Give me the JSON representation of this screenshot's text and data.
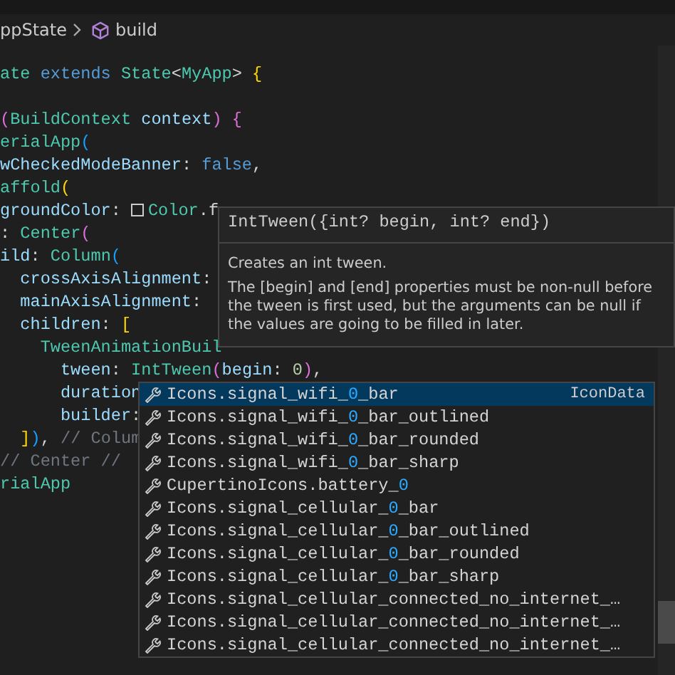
{
  "breadcrumb": {
    "parent": "ppState",
    "current": "build"
  },
  "code_lines": [
    {
      "tokens": [
        {
          "kind": "type",
          "text": "ate"
        },
        {
          "kind": "kw",
          "text": " extends"
        },
        {
          "kind": "type",
          "text": " State"
        },
        {
          "kind": "plain",
          "text": "<"
        },
        {
          "kind": "type",
          "text": "MyApp"
        },
        {
          "kind": "plain",
          "text": ">"
        },
        {
          "kind": "brace",
          "text": " {"
        }
      ]
    },
    {
      "blank_before": true,
      "tokens": [
        {
          "kind": "brace2",
          "text": "("
        },
        {
          "kind": "type",
          "text": "BuildContext"
        },
        {
          "kind": "prop",
          "text": " context"
        },
        {
          "kind": "brace2",
          "text": ")"
        },
        {
          "kind": "brace2",
          "text": " {"
        }
      ]
    },
    {
      "tokens": [
        {
          "kind": "type",
          "text": "erialApp"
        },
        {
          "kind": "brace3",
          "text": "("
        }
      ]
    },
    {
      "tokens": [
        {
          "kind": "prop",
          "text": "wCheckedModeBanner"
        },
        {
          "kind": "plain",
          "text": ":"
        },
        {
          "kind": "kw",
          "text": " false"
        },
        {
          "kind": "plain",
          "text": ","
        }
      ]
    },
    {
      "tokens": [
        {
          "kind": "type",
          "text": "affold"
        },
        {
          "kind": "brace",
          "text": "("
        }
      ]
    },
    {
      "tokens": [
        {
          "kind": "prop",
          "text": "groundColor"
        },
        {
          "kind": "plain",
          "text": ":"
        },
        {
          "kind": "swatch"
        },
        {
          "kind": "type",
          "text": "Color"
        },
        {
          "kind": "plain",
          "text": ".f"
        }
      ]
    },
    {
      "tokens": [
        {
          "kind": "plain",
          "text": ":"
        },
        {
          "kind": "type",
          "text": " Center"
        },
        {
          "kind": "brace2",
          "text": "("
        }
      ]
    },
    {
      "tokens": [
        {
          "kind": "prop",
          "text": "ild"
        },
        {
          "kind": "plain",
          "text": ":"
        },
        {
          "kind": "type",
          "text": " Column"
        },
        {
          "kind": "brace3",
          "text": "("
        }
      ]
    },
    {
      "tokens": [
        {
          "kind": "prop",
          "text": "  crossAxisAlignment"
        },
        {
          "kind": "plain",
          "text": ":"
        }
      ]
    },
    {
      "tokens": [
        {
          "kind": "prop",
          "text": "  mainAxisAlignment"
        },
        {
          "kind": "plain",
          "text": ":"
        }
      ]
    },
    {
      "tokens": [
        {
          "kind": "prop",
          "text": "  children"
        },
        {
          "kind": "plain",
          "text": ":"
        },
        {
          "kind": "brace",
          "text": " ["
        }
      ]
    },
    {
      "tokens": [
        {
          "kind": "type",
          "text": "    TweenAnimationBuil"
        }
      ]
    },
    {
      "tokens": [
        {
          "kind": "prop",
          "text": "      tween"
        },
        {
          "kind": "plain",
          "text": ":"
        },
        {
          "kind": "type",
          "text": " IntTween"
        },
        {
          "kind": "brace2",
          "text": "("
        },
        {
          "kind": "prop",
          "text": "begin"
        },
        {
          "kind": "plain",
          "text": ":"
        },
        {
          "kind": "num",
          "text": " 0"
        },
        {
          "kind": "brace2",
          "text": ")"
        },
        {
          "kind": "plain",
          "text": ","
        }
      ]
    },
    {
      "tokens": [
        {
          "kind": "prop",
          "text": "      duration"
        }
      ]
    },
    {
      "tokens": [
        {
          "kind": "prop",
          "text": "      builder"
        },
        {
          "kind": "plain",
          "text": ":"
        }
      ]
    },
    {
      "tokens": [
        {
          "kind": "brace",
          "text": "  ]"
        },
        {
          "kind": "brace3",
          "text": ")"
        },
        {
          "kind": "plain",
          "text": ","
        },
        {
          "kind": "comment",
          "text": " // Colum"
        }
      ]
    },
    {
      "tokens": [
        {
          "kind": "comment",
          "text": "// Center //"
        }
      ]
    },
    {
      "tokens": [
        {
          "kind": "type",
          "text": "rialApp"
        }
      ]
    }
  ],
  "hover": {
    "signature": "IntTween({int? begin, int? end})",
    "summary": "Creates an int tween.",
    "details": "The [begin] and [end] properties must be non-null before the tween is first used, but the arguments can be null if the values are going to be filled in later."
  },
  "suggestions": [
    {
      "label": "Icons.signal_wifi_**0**_bar",
      "type": "IconData",
      "selected": true
    },
    {
      "label": "Icons.signal_wifi_**0**_bar_outlined",
      "selected": false
    },
    {
      "label": "Icons.signal_wifi_**0**_bar_rounded",
      "selected": false
    },
    {
      "label": "Icons.signal_wifi_**0**_bar_sharp",
      "selected": false
    },
    {
      "label": "CupertinoIcons.battery_**0**",
      "selected": false
    },
    {
      "label": "Icons.signal_cellular_**0**_bar",
      "selected": false
    },
    {
      "label": "Icons.signal_cellular_**0**_bar_outlined",
      "selected": false
    },
    {
      "label": "Icons.signal_cellular_**0**_bar_rounded",
      "selected": false
    },
    {
      "label": "Icons.signal_cellular_**0**_bar_sharp",
      "selected": false
    },
    {
      "label": "Icons.signal_cellular_connected_no_internet_…",
      "selected": false
    },
    {
      "label": "Icons.signal_cellular_connected_no_internet_…",
      "selected": false
    },
    {
      "label": "Icons.signal_cellular_connected_no_internet_…",
      "selected": false
    }
  ]
}
